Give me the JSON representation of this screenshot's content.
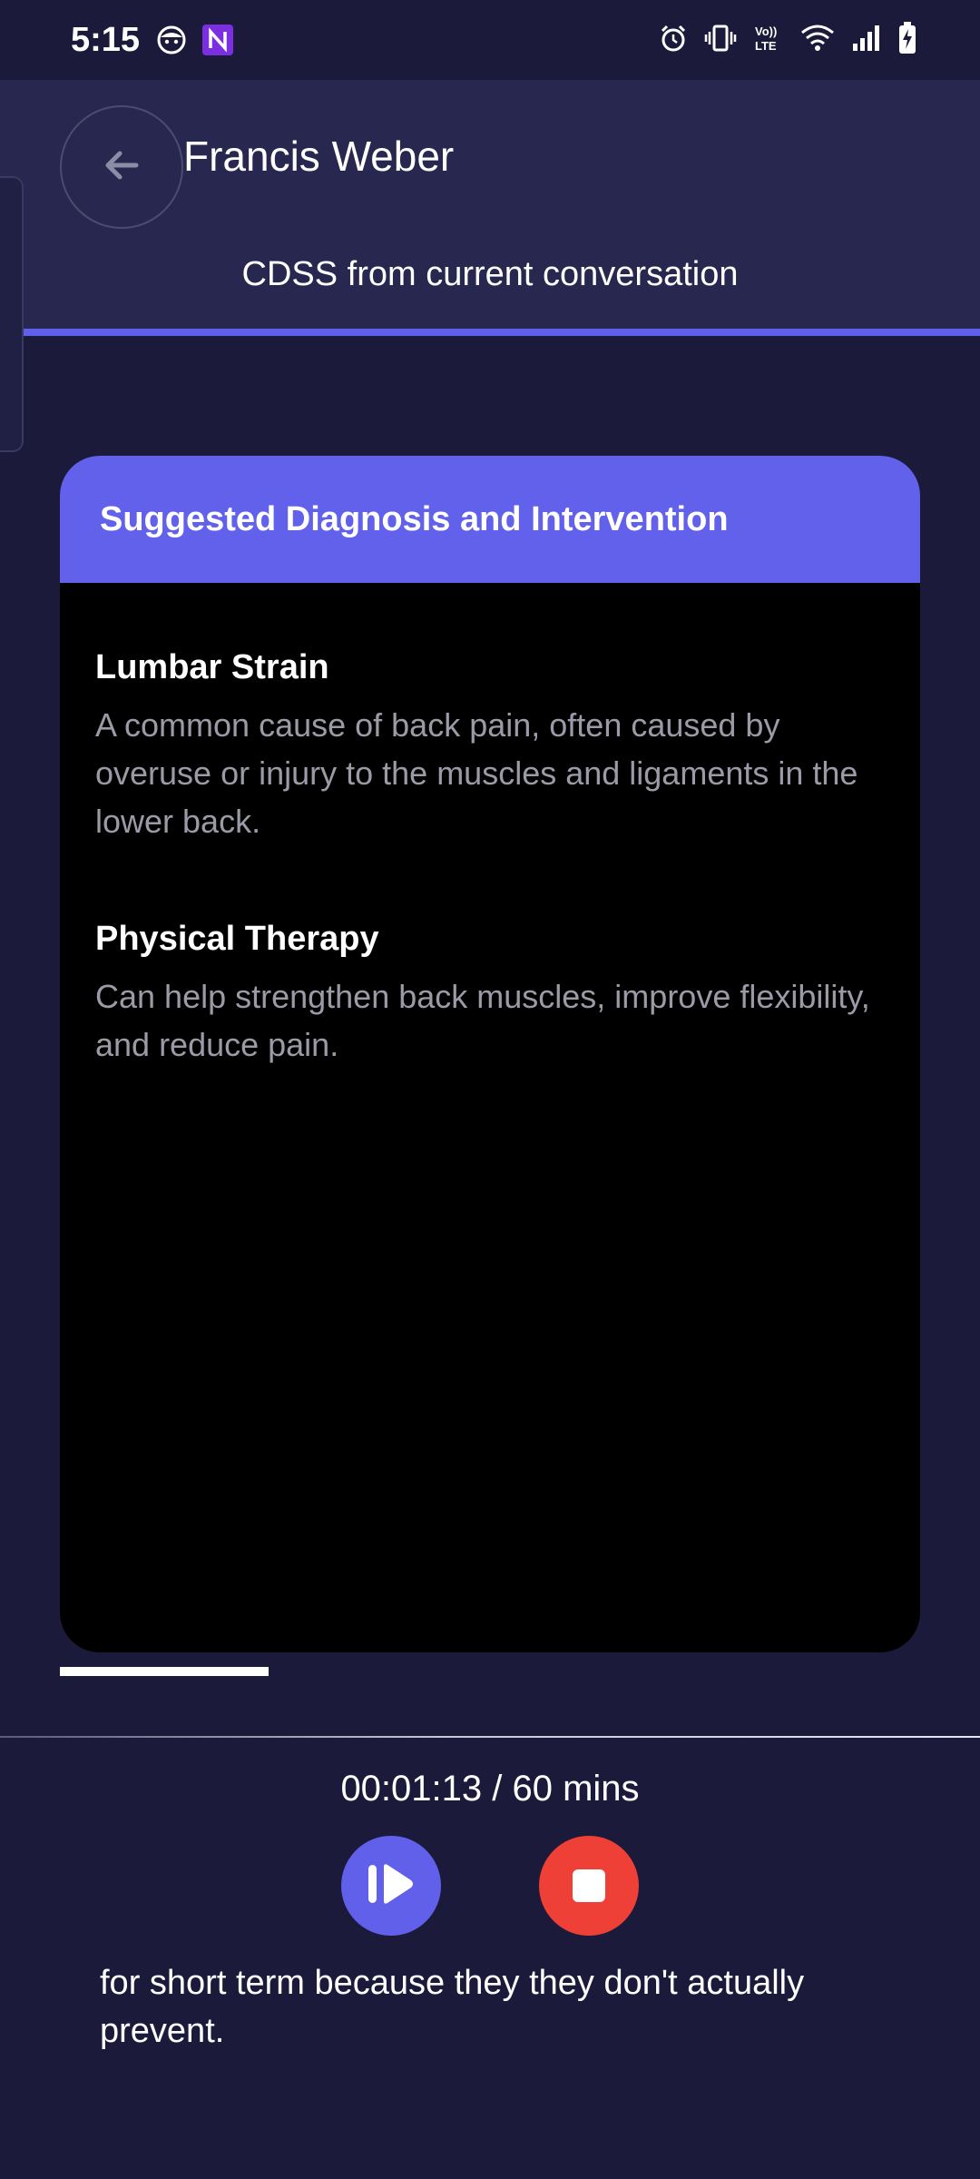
{
  "status_bar": {
    "time": "5:15",
    "left_icons": [
      "face-icon",
      "nfc-app-icon"
    ],
    "right_icons": [
      "alarm-icon",
      "vibrate-icon",
      "volte-icon",
      "wifi-icon",
      "signal-icon",
      "battery-charging-icon"
    ],
    "volte_label_top": "Vo))",
    "volte_label_bottom": "LTE"
  },
  "header": {
    "back_icon": "arrow-left-icon",
    "patient_name": "Francis Weber",
    "subtitle": "CDSS from current conversation"
  },
  "card": {
    "title": "Suggested Diagnosis and Intervention",
    "items": [
      {
        "title": "Lumbar Strain",
        "description": "A common cause of back pain, often caused by overuse or injury to the muscles and ligaments in the lower back."
      },
      {
        "title": "Physical Therapy",
        "description": "Can help strengthen back muscles, improve flexibility, and reduce pain."
      }
    ]
  },
  "recording": {
    "timer": "00:01:13 / 60 mins",
    "play_icon": "resume-icon",
    "stop_icon": "stop-icon"
  },
  "transcript": {
    "text": "for short term because they they don't actually prevent."
  },
  "colors": {
    "background": "#1b1a3a",
    "header": "#28274f",
    "accent": "#6161eb",
    "stop": "#ee4036",
    "card": "#000000",
    "muted_text": "#9b9ba8"
  }
}
